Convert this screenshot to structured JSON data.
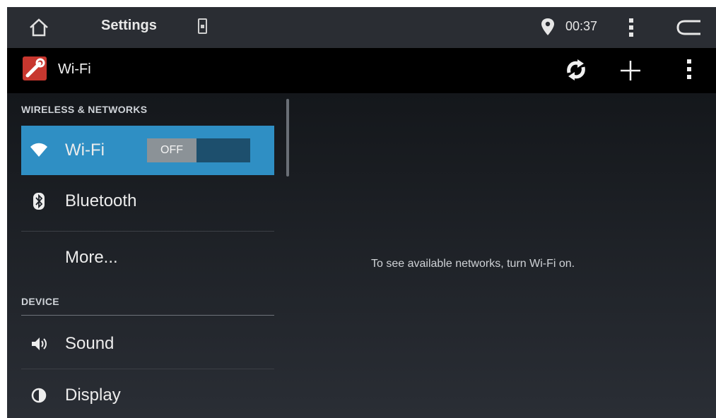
{
  "status_bar": {
    "title": "Settings",
    "time": "00:37"
  },
  "action_bar": {
    "title": "Wi-Fi"
  },
  "sections": {
    "wireless_header": "WIRELESS & NETWORKS",
    "device_header": "DEVICE"
  },
  "items": {
    "wifi": "Wi-Fi",
    "wifi_toggle": "OFF",
    "bluetooth": "Bluetooth",
    "more": "More...",
    "sound": "Sound",
    "display": "Display"
  },
  "main": {
    "message": "To see available networks, turn Wi-Fi on."
  },
  "colors": {
    "accent": "#2f8fc4",
    "app_icon": "#c8372f"
  },
  "icons": [
    "home-icon",
    "battery-icon",
    "location-icon",
    "overflow-icon",
    "back-icon",
    "settings-app-icon",
    "refresh-icon",
    "add-icon",
    "wifi-icon",
    "bluetooth-icon",
    "sound-icon",
    "display-icon"
  ]
}
